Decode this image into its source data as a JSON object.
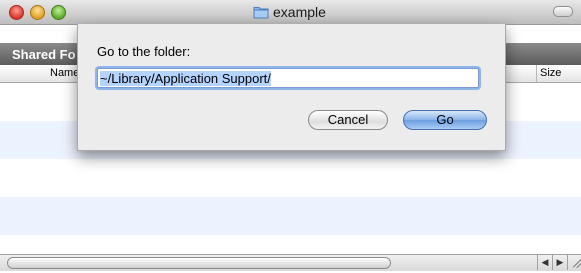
{
  "window": {
    "title": "example"
  },
  "sidebar_header": {
    "label": "Shared Fo"
  },
  "columns": {
    "name": "Name",
    "size": "Size"
  },
  "scrollbar": {
    "left_arrow": "◀",
    "right_arrow": "▶"
  },
  "dialog": {
    "prompt": "Go to the folder:",
    "path_value": "~/Library/Application Support/",
    "cancel_label": "Cancel",
    "go_label": "Go"
  },
  "colors": {
    "row_alt": "#edf3fe",
    "default_button": "#6d9fe0",
    "focus_ring": "#8fb6ea"
  }
}
